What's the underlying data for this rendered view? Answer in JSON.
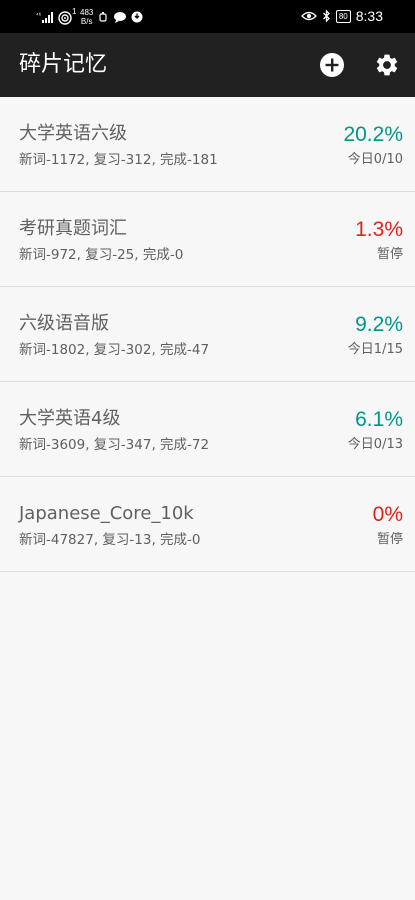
{
  "status_bar": {
    "signal_label": "⁴⁶",
    "wifi_badge": "1",
    "speed_value": "483",
    "speed_unit": "B/s",
    "battery": "80",
    "time": "8:33"
  },
  "app_bar": {
    "title": "碎片记忆",
    "add_icon": "add-circle-icon",
    "settings_icon": "gear-icon"
  },
  "colors": {
    "teal": "#00968a",
    "red": "#e0201c"
  },
  "decks": [
    {
      "name": "大学英语六级",
      "stats": "新词-1172, 复习-312, 完成-181",
      "percent": "20.2%",
      "status": "今日0/10",
      "color": "#00968a"
    },
    {
      "name": "考研真题词汇",
      "stats": "新词-972, 复习-25, 完成-0",
      "percent": "1.3%",
      "status": "暂停",
      "color": "#e0201c"
    },
    {
      "name": "六级语音版",
      "stats": "新词-1802, 复习-302, 完成-47",
      "percent": "9.2%",
      "status": "今日1/15",
      "color": "#00968a"
    },
    {
      "name": "大学英语4级",
      "stats": "新词-3609, 复习-347, 完成-72",
      "percent": "6.1%",
      "status": "今日0/13",
      "color": "#00968a"
    },
    {
      "name": "Japanese_Core_10k",
      "stats": "新词-47827, 复习-13, 完成-0",
      "percent": "0%",
      "status": "暂停",
      "color": "#e0201c"
    }
  ]
}
